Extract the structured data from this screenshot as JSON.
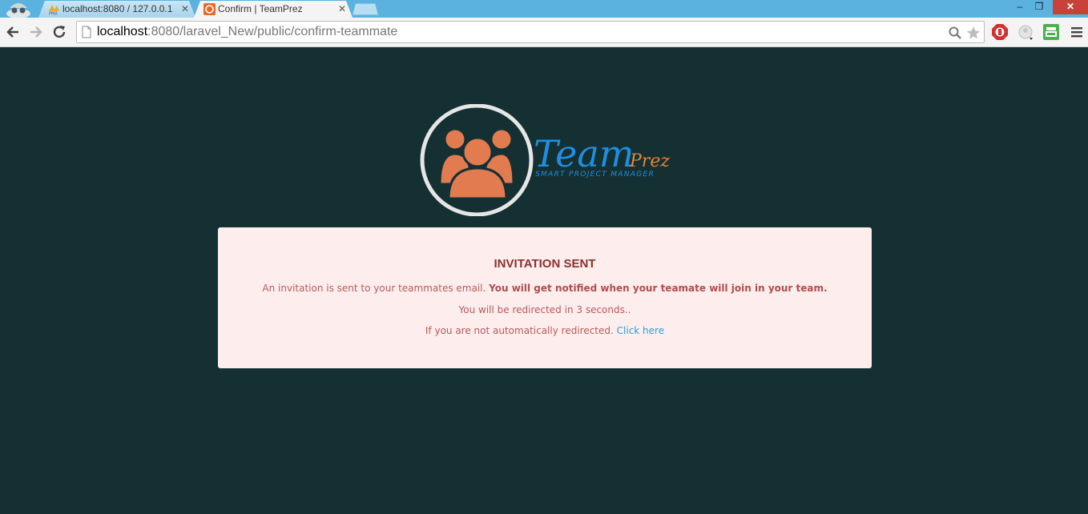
{
  "browser": {
    "tabs": [
      {
        "title": "localhost:8080 / 127.0.0.1",
        "favicon": "pma-icon",
        "active": false
      },
      {
        "title": "Confirm | TeamPrez",
        "favicon": "teamprez-favicon",
        "active": true
      }
    ],
    "url_host": "localhost",
    "url_rest": ":8080/laravel_New/public/confirm-teammate",
    "window_controls": {
      "minimize": "‒",
      "maximize": "❐",
      "close": "✕"
    }
  },
  "logo": {
    "brand_main": "Team",
    "brand_suffix": "Prez",
    "tagline": "SMART PROJECT MANAGER"
  },
  "notice": {
    "title": "INVITATION SENT",
    "line1_normal": "An invitation is sent to your teammates email. ",
    "line1_bold": "You will get notified when your teamate will join in your team.",
    "line2": "You will be redirected in 3 seconds..",
    "line3_text": "If you are not automatically redirected. ",
    "line3_link": "Click here"
  },
  "colors": {
    "page_bg": "#153033",
    "card_bg": "#fdeeed",
    "card_text": "#b85a5a",
    "link": "#2a9fd6",
    "logo_orange": "#e37b50",
    "logo_blue": "#1f8ee0"
  }
}
